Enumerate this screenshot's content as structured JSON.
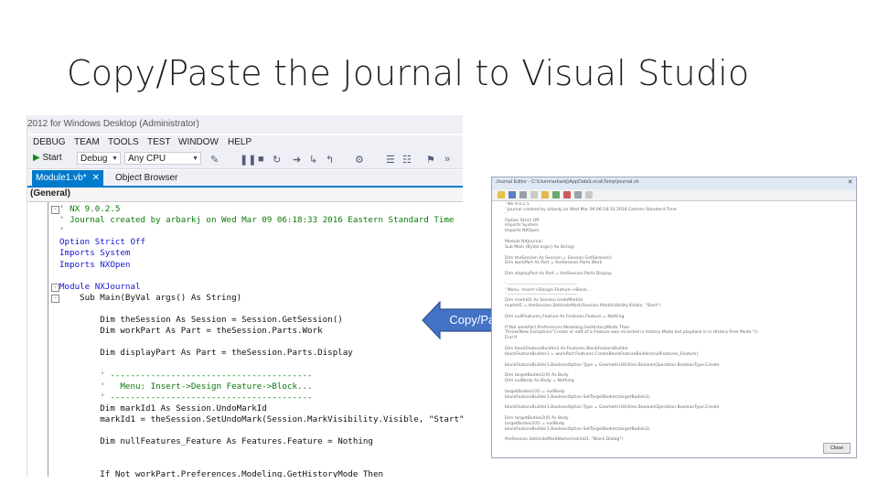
{
  "slide": {
    "title": "Copy/Paste the Journal to Visual Studio"
  },
  "vs": {
    "title": "2012 for Windows Desktop (Administrator)",
    "menu": [
      "DEBUG",
      "TEAM",
      "TOOLS",
      "TEST",
      "WINDOW",
      "HELP"
    ],
    "toolbar": {
      "start_label": "Start",
      "config": "Debug",
      "platform": "Any CPU"
    },
    "tabs": {
      "active": "Module1.vb*",
      "close": "✕",
      "other": "Object Browser"
    },
    "nav_combo": "(General)",
    "code": [
      {
        "text": "' NX 9.0.2.5",
        "cls": "cmt"
      },
      {
        "text": "' Journal created by arbarkj on Wed Mar 09 06:18:33 2016 Eastern Standard Time",
        "cls": "cmt"
      },
      {
        "text": "'",
        "cls": "cmt"
      },
      {
        "text": "Option Strict Off",
        "cls": "kw"
      },
      {
        "text": "Imports System",
        "cls": "kw"
      },
      {
        "text": "Imports NXOpen",
        "cls": "kw"
      },
      {
        "text": "",
        "cls": ""
      },
      {
        "text": "Module NXJournal",
        "cls": "kw"
      },
      {
        "text": "    Sub Main(ByVal args() As String)",
        "cls": ""
      },
      {
        "text": "",
        "cls": ""
      },
      {
        "text": "        Dim theSession As Session = Session.GetSession()",
        "cls": ""
      },
      {
        "text": "        Dim workPart As Part = theSession.Parts.Work",
        "cls": ""
      },
      {
        "text": "",
        "cls": ""
      },
      {
        "text": "        Dim displayPart As Part = theSession.Parts.Display",
        "cls": ""
      },
      {
        "text": "",
        "cls": ""
      },
      {
        "text": "        ' ----------------------------------------",
        "cls": "cmt"
      },
      {
        "text": "        '   Menu: Insert->Design Feature->Block...",
        "cls": "cmt"
      },
      {
        "text": "        ' ----------------------------------------",
        "cls": "cmt"
      },
      {
        "text": "        Dim markId1 As Session.UndoMarkId",
        "cls": ""
      },
      {
        "text": "        markId1 = theSession.SetUndoMark(Session.MarkVisibility.Visible, \"Start\")",
        "cls": ""
      },
      {
        "text": "",
        "cls": ""
      },
      {
        "text": "        Dim nullFeatures_Feature As Features.Feature = Nothing",
        "cls": ""
      },
      {
        "text": "",
        "cls": ""
      },
      {
        "text": "",
        "cls": ""
      },
      {
        "text": "        If Not workPart.Preferences.Modeling.GetHistoryMode Then",
        "cls": ""
      }
    ]
  },
  "callout": {
    "label": "Copy/Paste",
    "color": "#4472c4"
  },
  "journal": {
    "title": "Journal Editor - C:\\Users\\arbarkj\\AppData\\Local\\Temp\\journal.vb",
    "close_button": "Close",
    "lines": [
      "' NX 9.0.2.5",
      "' Journal created by arbarkj on Wed Mar 09 06:18:33 2016 Eastern Standard Time",
      "'",
      "Option Strict Off",
      "Imports System",
      "Imports NXOpen",
      "",
      "Module NXJournal",
      "Sub Main (ByVal args() As String)",
      "",
      "Dim theSession As Session = Session.GetSession()",
      "Dim workPart As Part = theSession.Parts.Work",
      "",
      "Dim displayPart As Part = theSession.Parts.Display",
      "",
      "' ----------------------------------------------",
      "'   Menu: Insert->Design Feature->Block...",
      "' ----------------------------------------------",
      "Dim markId1 As Session.UndoMarkId",
      "markId1 = theSession.SetUndoMark(Session.MarkVisibility.Visible, \"Start\")",
      "",
      "Dim nullFeatures_Feature As Features.Feature = Nothing",
      "",
      "If Not workPart.Preferences.Modeling.GetHistoryMode Then",
      "Throw(New Exception(\"Create or edit of a Feature was recorded in History Mode but playback is in History-Free Mode.\"))",
      "End If",
      "",
      "Dim blockFeatureBuilder1 As Features.BlockFeatureBuilder",
      "blockFeatureBuilder1 = workPart.Features.CreateBlockFeatureBuilder(nullFeatures_Feature)",
      "",
      "blockFeatureBuilder1.BooleanOption.Type = GeometricUtilities.BooleanOperation.BooleanType.Create",
      "",
      "Dim targetBodies1(0) As Body",
      "Dim nullBody As Body = Nothing",
      "",
      "targetBodies1(0) = nullBody",
      "blockFeatureBuilder1.BooleanOption.SetTargetBodies(targetBodies1)",
      "",
      "blockFeatureBuilder1.BooleanOption.Type = GeometricUtilities.BooleanOperation.BooleanType.Create",
      "",
      "Dim targetBodies2(0) As Body",
      "targetBodies2(0) = nullBody",
      "blockFeatureBuilder1.BooleanOption.SetTargetBodies(targetBodies2)",
      "",
      "theSession.SetUndoMarkName(markId1, \"Block Dialog\")"
    ]
  }
}
